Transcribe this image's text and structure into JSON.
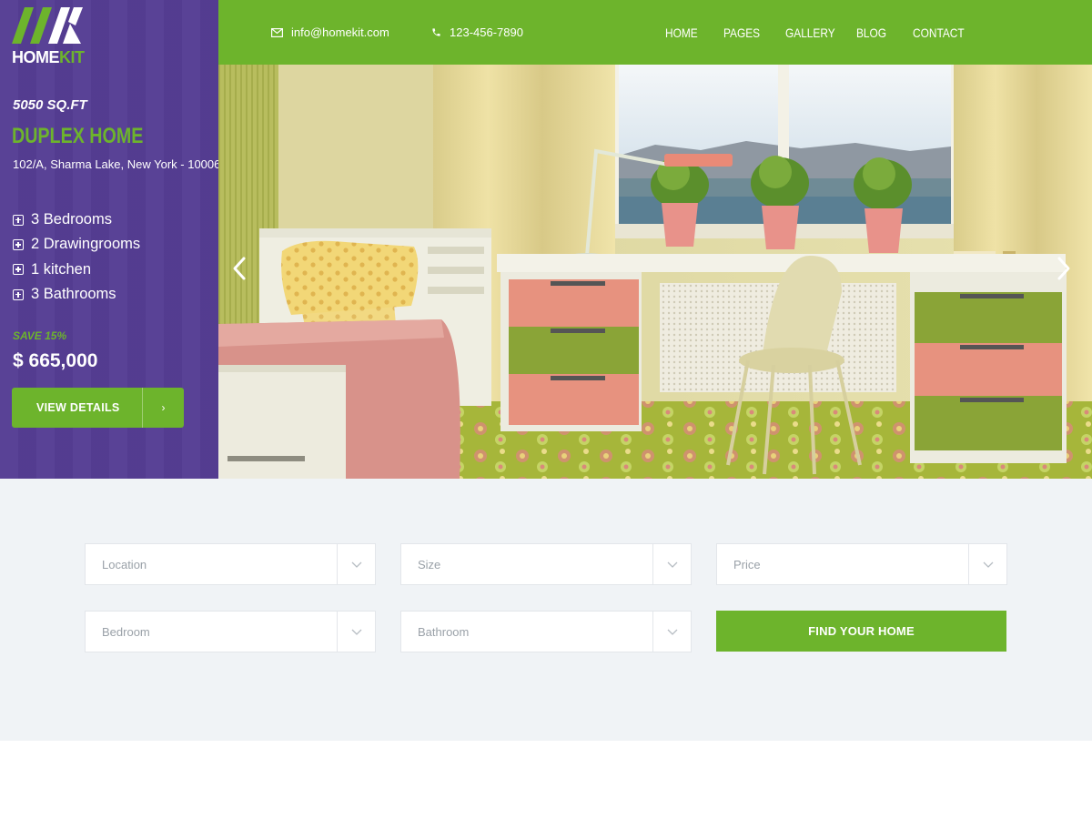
{
  "brand": {
    "logo_mark": "HK",
    "name_main": "HOME",
    "name_accent": "KIT",
    "green": "#6db42c",
    "purple": "#553d93"
  },
  "header": {
    "email": "info@homekit.com",
    "phone": "123-456-7890",
    "email_icon": "envelope-icon",
    "phone_icon": "phone-icon",
    "nav": [
      "HOME",
      "PAGES",
      "GALLERY",
      "BLOG",
      "CONTACT"
    ]
  },
  "property": {
    "area": "5050 SQ.FT",
    "title": "DUPLEX HOME",
    "address": "102/A, Sharma Lake, New York - 10006",
    "features": [
      "3 Bedrooms",
      "2 Drawingrooms",
      "1 kitchen",
      "3 Bathrooms"
    ],
    "discount": "SAVE 15%",
    "price": "$ 665,000",
    "cta_label": "VIEW DETAILS",
    "cta_arrow": "›"
  },
  "slider": {
    "prev_icon": "chevron-left-icon",
    "next_icon": "chevron-right-icon"
  },
  "search": {
    "fields": [
      {
        "placeholder": "Location"
      },
      {
        "placeholder": "Size"
      },
      {
        "placeholder": "Price"
      },
      {
        "placeholder": "Bedroom"
      },
      {
        "placeholder": "Bathroom"
      }
    ],
    "submit_label": "FIND YOUR HOME"
  }
}
